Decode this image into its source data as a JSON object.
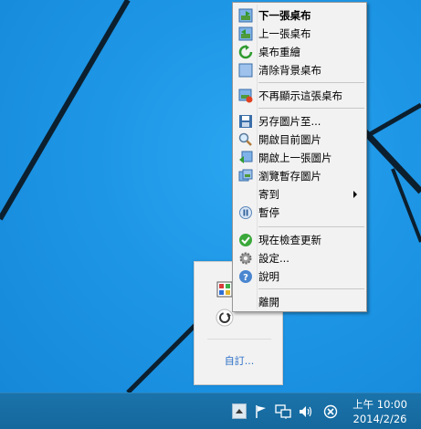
{
  "context_menu": {
    "items": [
      {
        "label": "下一張桌布",
        "icon": "next-wallpaper-icon",
        "bold": true
      },
      {
        "label": "上一張桌布",
        "icon": "previous-wallpaper-icon"
      },
      {
        "label": "桌布重繪",
        "icon": "redraw-icon"
      },
      {
        "label": "清除背景桌布",
        "icon": "clear-background-icon"
      },
      {
        "label": "不再顯示這張桌布",
        "icon": "ban-wallpaper-icon"
      },
      {
        "label": "另存圖片至...",
        "icon": "save-icon"
      },
      {
        "label": "開啟目前圖片",
        "icon": "magnifier-icon"
      },
      {
        "label": "開啟上一張圖片",
        "icon": "open-previous-icon"
      },
      {
        "label": "瀏覽暫存圖片",
        "icon": "browse-cache-icon"
      },
      {
        "label": "寄到",
        "icon": "",
        "submenu": true
      },
      {
        "label": "暫停",
        "icon": "pause-icon"
      },
      {
        "label": "現在檢查更新",
        "icon": "check-update-icon"
      },
      {
        "label": "設定...",
        "icon": "gear-icon"
      },
      {
        "label": "說明",
        "icon": "help-icon"
      },
      {
        "label": "離開",
        "icon": ""
      }
    ]
  },
  "tray_popup": {
    "customize_label": "自訂..."
  },
  "clock": {
    "time": "上午 10:00",
    "date": "2014/2/26"
  },
  "colors": {
    "desktop": "#1e96e6",
    "taskbar": "#1a73ab",
    "menu_bg": "#f2f2f2",
    "link": "#2a6ec6"
  }
}
